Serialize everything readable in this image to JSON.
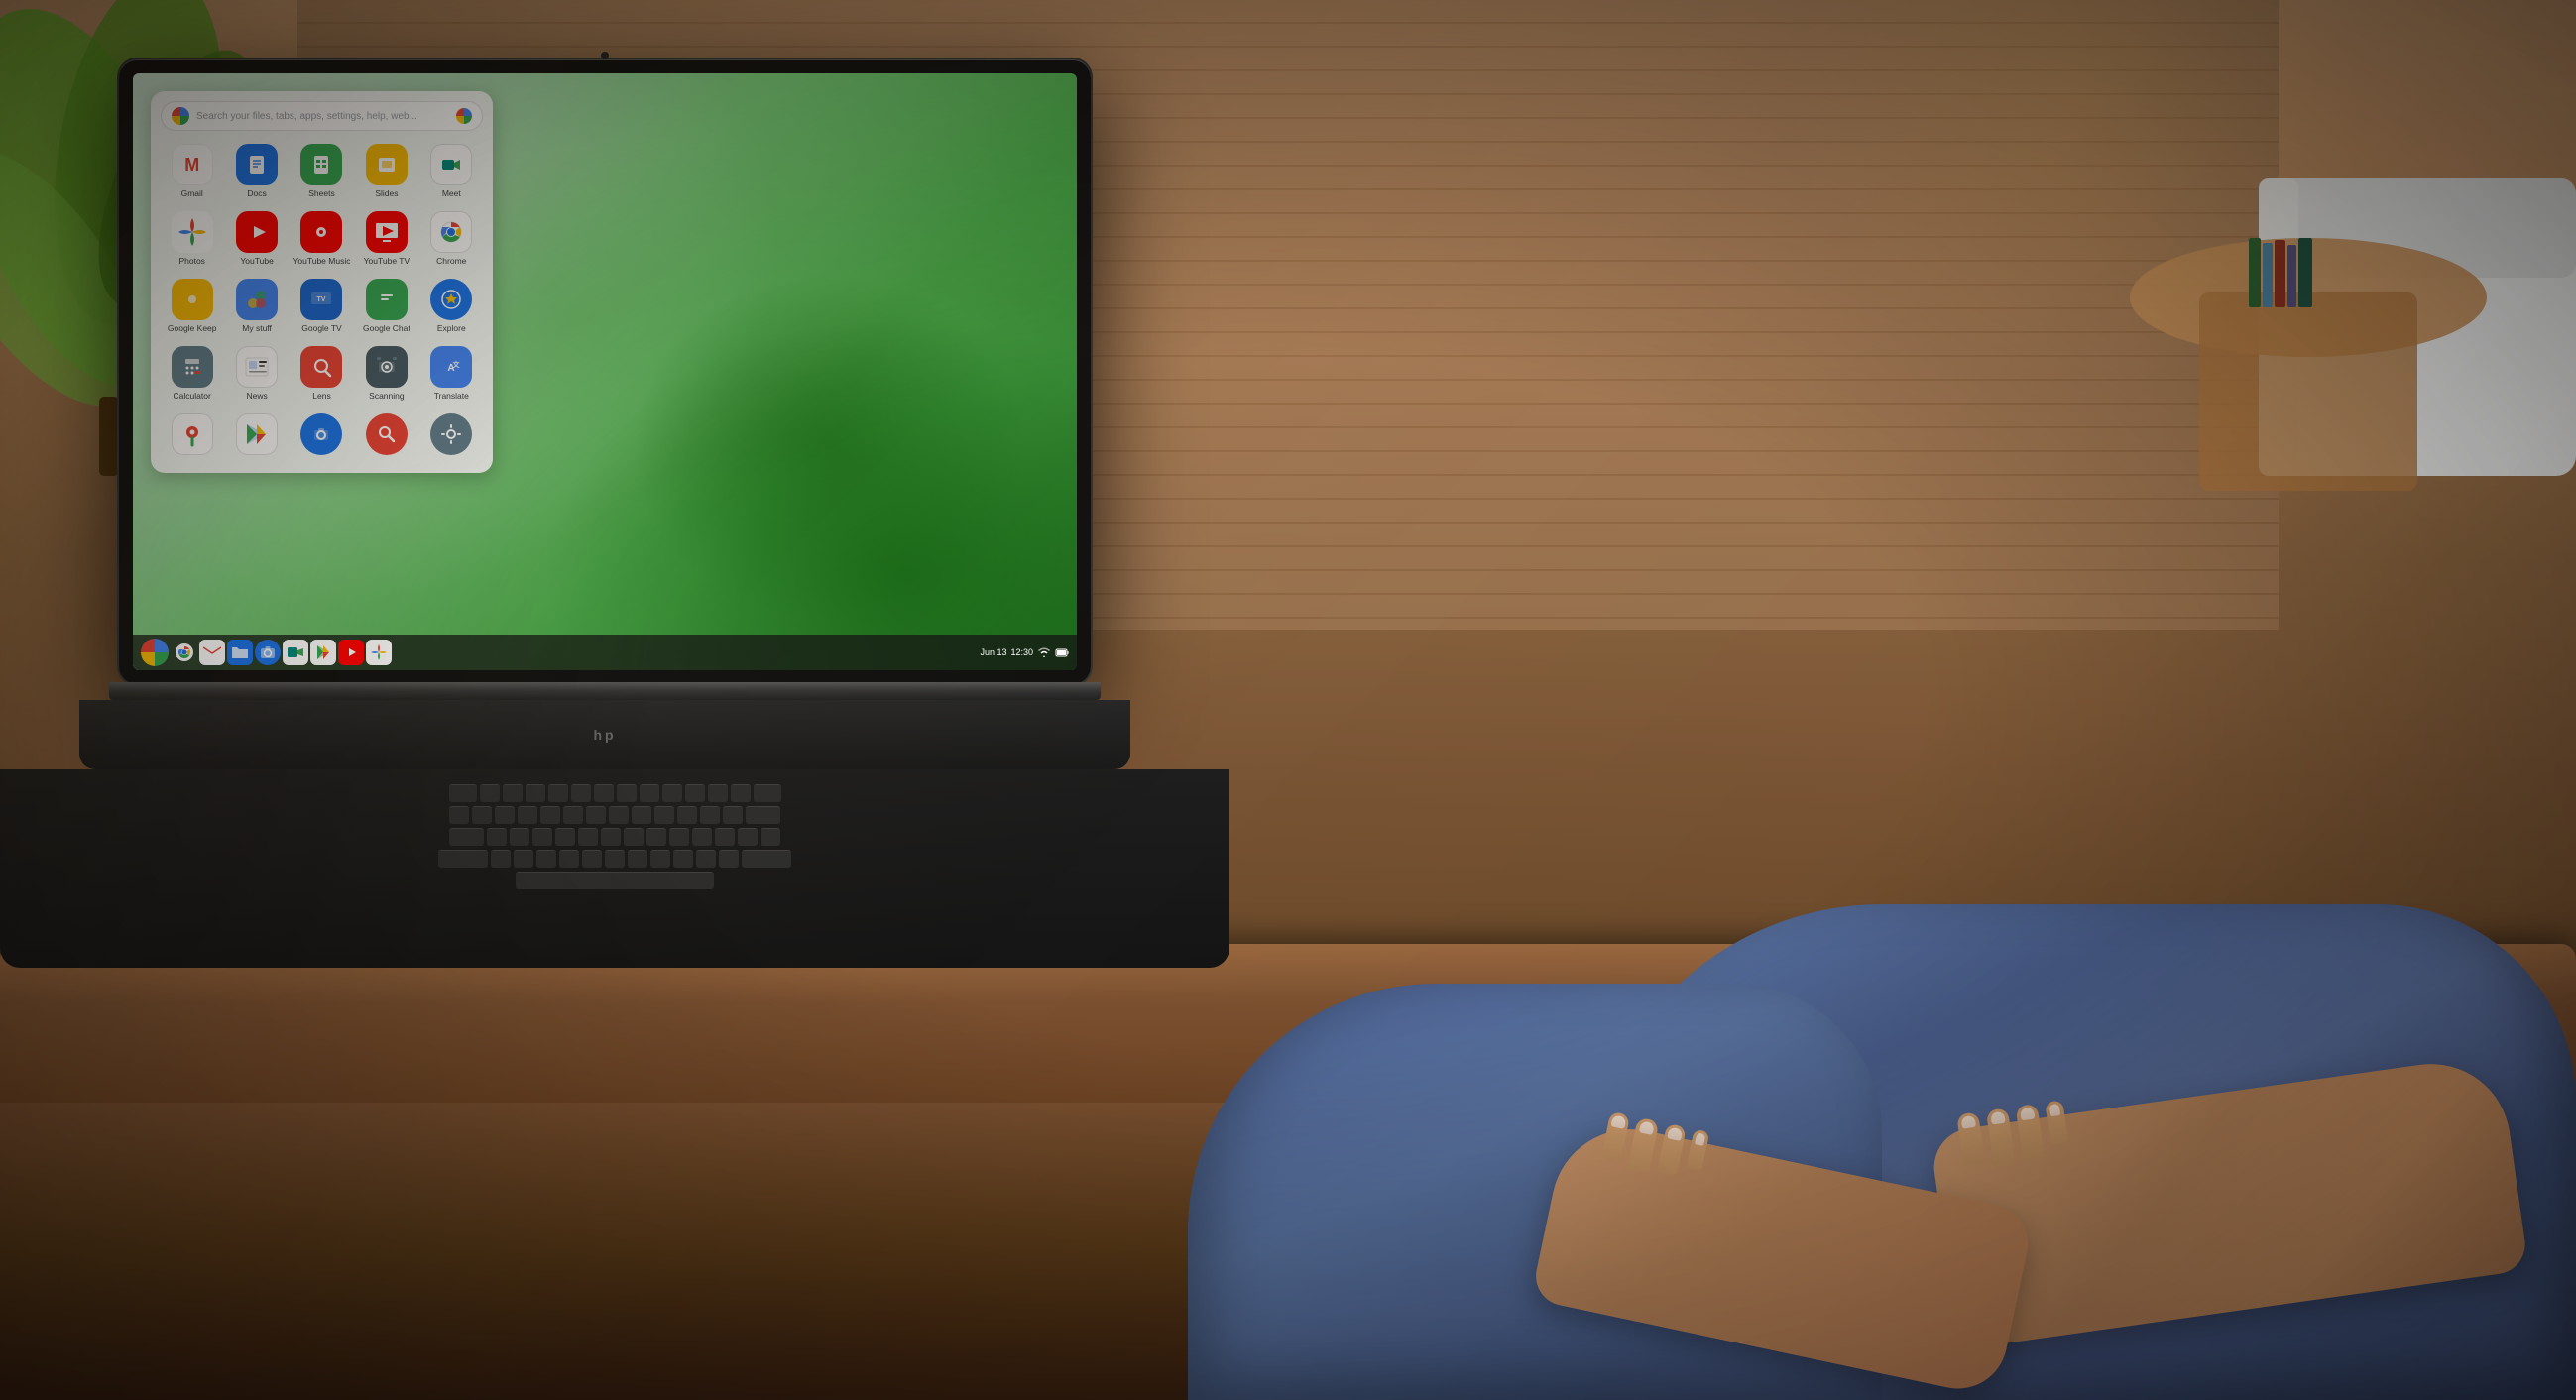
{
  "scene": {
    "title": "HP Chromebook with ChromeOS app launcher",
    "laptop_brand": "hp"
  },
  "chromeos": {
    "search_placeholder": "Search your files, tabs, apps, settings, help, web...",
    "taskbar": {
      "date": "Jun 13",
      "time": "12:30",
      "wifi": true,
      "battery": true
    },
    "apps": [
      {
        "id": "gmail",
        "label": "Gmail",
        "row": 1
      },
      {
        "id": "docs",
        "label": "Docs",
        "row": 1
      },
      {
        "id": "sheets",
        "label": "Sheets",
        "row": 1
      },
      {
        "id": "slides",
        "label": "Slides",
        "row": 1
      },
      {
        "id": "meet",
        "label": "Meet",
        "row": 1
      },
      {
        "id": "photos",
        "label": "Photos",
        "row": 2
      },
      {
        "id": "youtube",
        "label": "YouTube",
        "row": 2
      },
      {
        "id": "ytmusic",
        "label": "YouTube Music",
        "row": 2
      },
      {
        "id": "yttv",
        "label": "YouTube TV",
        "row": 2
      },
      {
        "id": "chrome",
        "label": "Chrome",
        "row": 2
      },
      {
        "id": "keep",
        "label": "Google Keep",
        "row": 3
      },
      {
        "id": "mystuff",
        "label": "My stuff",
        "row": 3
      },
      {
        "id": "googletv",
        "label": "Google TV",
        "row": 3
      },
      {
        "id": "chat",
        "label": "Google Chat",
        "row": 3
      },
      {
        "id": "explore",
        "label": "Explore",
        "row": 3
      },
      {
        "id": "calculator",
        "label": "Calculator",
        "row": 4
      },
      {
        "id": "news",
        "label": "News",
        "row": 4
      },
      {
        "id": "lens",
        "label": "Lens",
        "row": 4
      },
      {
        "id": "scanning",
        "label": "Scanning",
        "row": 4
      },
      {
        "id": "translate",
        "label": "Translate",
        "row": 4
      },
      {
        "id": "maps",
        "label": "",
        "row": 5
      },
      {
        "id": "playstore",
        "label": "",
        "row": 5
      },
      {
        "id": "camera",
        "label": "",
        "row": 5
      },
      {
        "id": "redsearch",
        "label": "",
        "row": 5
      },
      {
        "id": "gear",
        "label": "",
        "row": 5
      }
    ],
    "taskbar_apps": [
      {
        "id": "chrome",
        "label": "Chrome"
      },
      {
        "id": "gmail",
        "label": "Gmail"
      },
      {
        "id": "files",
        "label": "Files"
      },
      {
        "id": "camera2",
        "label": "Camera"
      },
      {
        "id": "meet2",
        "label": "Meet"
      },
      {
        "id": "playstore2",
        "label": "Play Store"
      },
      {
        "id": "yttb",
        "label": "YouTube"
      },
      {
        "id": "photos2",
        "label": "Photos"
      }
    ]
  }
}
